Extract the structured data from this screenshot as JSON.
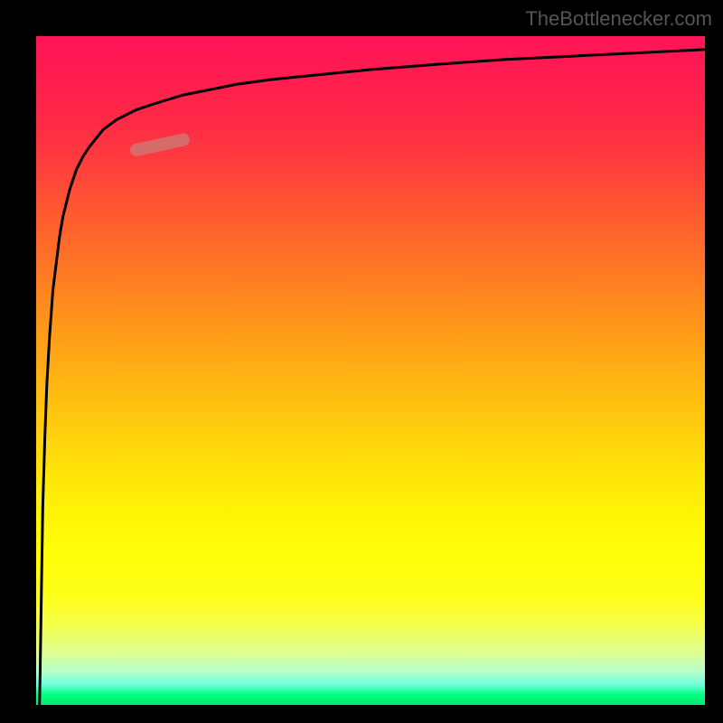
{
  "watermark": "TheBottlenecker.com",
  "chart_data": {
    "type": "line",
    "title": "",
    "xlabel": "",
    "ylabel": "",
    "xlim": [
      0,
      100
    ],
    "ylim": [
      0,
      100
    ],
    "x": [
      0.5,
      0.6,
      0.8,
      1.0,
      1.3,
      1.6,
      2.0,
      2.5,
      3.0,
      3.5,
      4.0,
      5.0,
      6.0,
      7.0,
      8.0,
      10.0,
      12.0,
      15.0,
      18.0,
      22.0,
      26.0,
      30.0,
      35.0,
      40.0,
      50.0,
      60.0,
      70.0,
      80.0,
      90.0,
      100.0
    ],
    "values": [
      0,
      5,
      18,
      30,
      40,
      48,
      55,
      62,
      66,
      70,
      73,
      77,
      80,
      82,
      83.5,
      86,
      87.5,
      89,
      90,
      91.2,
      92,
      92.8,
      93.5,
      94,
      95,
      95.8,
      96.5,
      97,
      97.5,
      98
    ],
    "highlight_segment": {
      "x": [
        15,
        22
      ],
      "values": [
        83,
        84.5
      ]
    },
    "background_gradient": {
      "direction": "vertical",
      "stops": [
        {
          "pos": 0,
          "color": "#ff1557"
        },
        {
          "pos": 50,
          "color": "#ffb012"
        },
        {
          "pos": 80,
          "color": "#fffe08"
        },
        {
          "pos": 98,
          "color": "#00ff7f"
        },
        {
          "pos": 100,
          "color": "#00e872"
        }
      ]
    }
  }
}
